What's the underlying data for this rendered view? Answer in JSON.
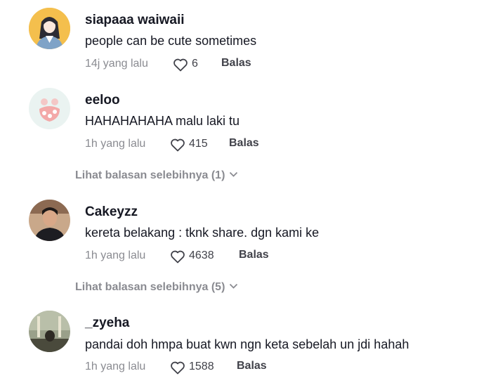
{
  "comments": [
    {
      "username": "siapaaa waiwaii",
      "text": "people can be cute sometimes",
      "time": "14j yang lalu",
      "likes": "6",
      "reply": "Balas",
      "avatar": "girl-illustration-avatar"
    },
    {
      "username": "eeloo",
      "text": "HAHAHAHAHA malu laki tu",
      "time": "1h yang lalu",
      "likes": "415",
      "reply": "Balas",
      "avatar": "pink-pattern-avatar"
    },
    {
      "username": "Cakeyzz",
      "text": "kereta belakang : tknk share. dgn kami ke",
      "time": "1h yang lalu",
      "likes": "4638",
      "reply": "Balas",
      "avatar": "man-photo-avatar"
    },
    {
      "username": "_zyeha",
      "text": "pandai doh hmpa buat kwn ngn keta sebelah un jdi hahah",
      "time": "1h yang lalu",
      "likes": "1588",
      "reply": "Balas",
      "avatar": "room-photo-avatar"
    }
  ],
  "view_more": [
    {
      "label": "Lihat balasan selebihnya (1)"
    },
    {
      "label": "Lihat balasan selebihnya (5)"
    }
  ],
  "icons": {
    "like": "heart-outline-icon",
    "expand": "chevron-down-icon"
  },
  "colors": {
    "primary_text": "#161823",
    "secondary_text": "#8a8b91",
    "icon": "#41424a"
  }
}
